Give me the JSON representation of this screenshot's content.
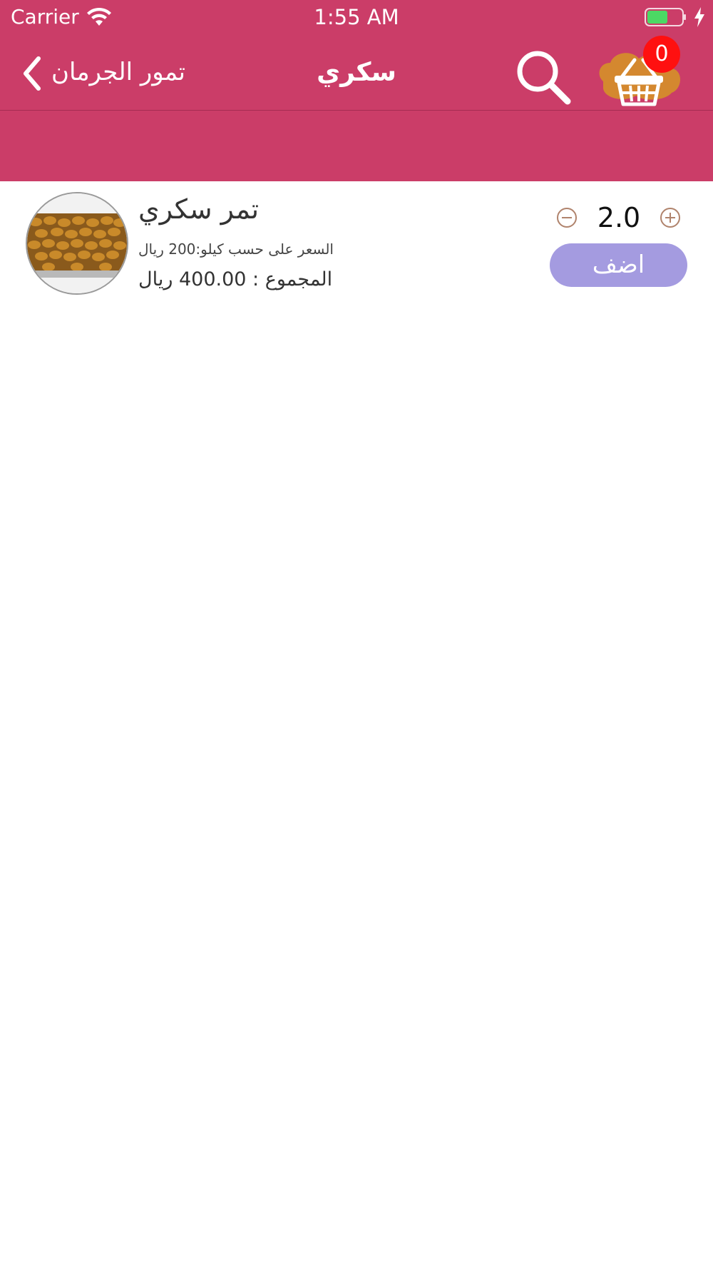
{
  "status_bar": {
    "carrier": "Carrier",
    "time": "1:55 AM",
    "battery_color": "#4cd964"
  },
  "nav": {
    "back_label": "تمور الجرمان",
    "title": "سكري",
    "cart_count": "0",
    "background_color": "#cb3d68"
  },
  "product": {
    "name": "تمر سكري",
    "price_line": "السعر على حسب كيلو:200 ريال",
    "total_line": "المجموع : 400.00 ريال",
    "quantity": "2.0",
    "add_label": "اضف",
    "add_button_color": "#a49be0"
  }
}
